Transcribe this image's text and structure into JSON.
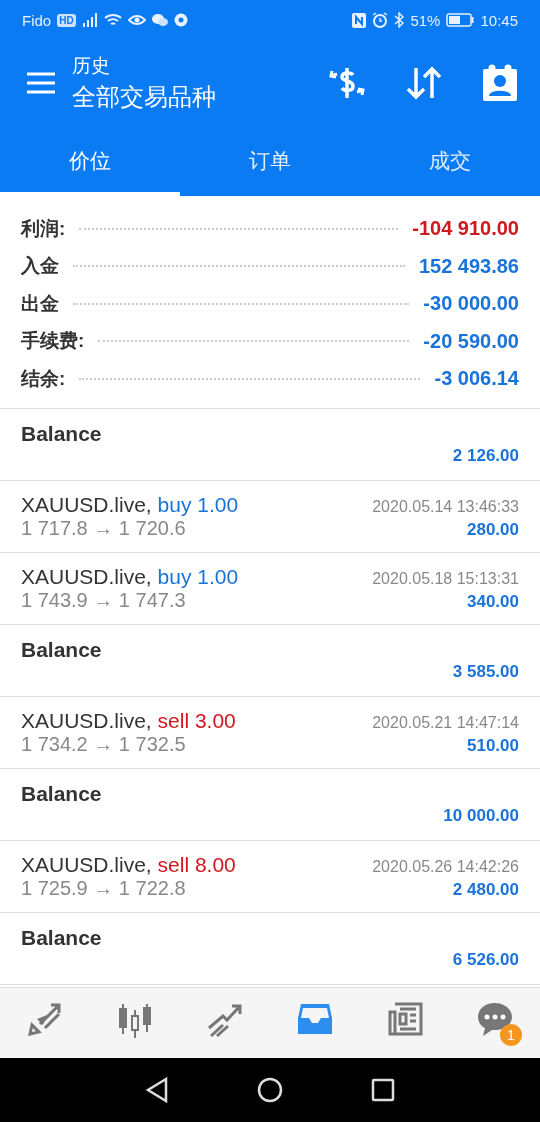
{
  "status_bar": {
    "carrier": "Fido",
    "carrier_badge": "HD",
    "battery_percent": "51%",
    "time": "10:45"
  },
  "header": {
    "subtitle": "历史",
    "title": "全部交易品种"
  },
  "tabs": [
    {
      "label": "价位",
      "selected": true
    },
    {
      "label": "订单",
      "selected": false
    },
    {
      "label": "成交",
      "selected": false
    }
  ],
  "summary": [
    {
      "label": "利润:",
      "value": "-104 910.00",
      "color": "#d0191e"
    },
    {
      "label": "入金",
      "value": "152 493.86",
      "color": "#1a73d9"
    },
    {
      "label": "出金",
      "value": "-30 000.00",
      "color": "#1a73d9"
    },
    {
      "label": "手续费:",
      "value": "-20 590.00",
      "color": "#1a73d9"
    },
    {
      "label": "结余:",
      "value": "-3 006.14",
      "color": "#1a73d9"
    }
  ],
  "deals": [
    {
      "kind": "balance",
      "title": "Balance",
      "amount": "2 126.00"
    },
    {
      "kind": "trade",
      "symbol": "XAUUSD.live,",
      "color": "#1a73d9",
      "action": "buy 1.00",
      "time": "2020.05.14 13:46:33",
      "prices": "1 717.8 → 1 720.6",
      "profit": "280.00"
    },
    {
      "kind": "trade",
      "symbol": "XAUUSD.live,",
      "color": "#1a73d9",
      "action": "buy 1.00",
      "time": "2020.05.18 15:13:31",
      "prices": "1 743.9 → 1 747.3",
      "profit": "340.00"
    },
    {
      "kind": "balance",
      "title": "Balance",
      "amount": "3 585.00"
    },
    {
      "kind": "trade",
      "symbol": "XAUUSD.live,",
      "color": "#d0191e",
      "action": "sell 3.00",
      "time": "2020.05.21 14:47:14",
      "prices": "1 734.2 → 1 732.5",
      "profit": "510.00"
    },
    {
      "kind": "balance",
      "title": "Balance",
      "amount": "10 000.00"
    },
    {
      "kind": "trade",
      "symbol": "XAUUSD.live,",
      "color": "#d0191e",
      "action": "sell 8.00",
      "time": "2020.05.26 14:42:26",
      "prices": "1 725.9 → 1 722.8",
      "profit": "2 480.00"
    },
    {
      "kind": "balance",
      "title": "Balance",
      "amount": "6 526.00"
    }
  ],
  "bottom_nav": [
    {
      "kind": "quotes",
      "selected": false
    },
    {
      "kind": "chart",
      "selected": false
    },
    {
      "kind": "trade",
      "selected": false
    },
    {
      "kind": "history",
      "selected": true
    },
    {
      "kind": "news",
      "selected": false
    },
    {
      "kind": "chat",
      "selected": false,
      "badge": "1"
    }
  ]
}
